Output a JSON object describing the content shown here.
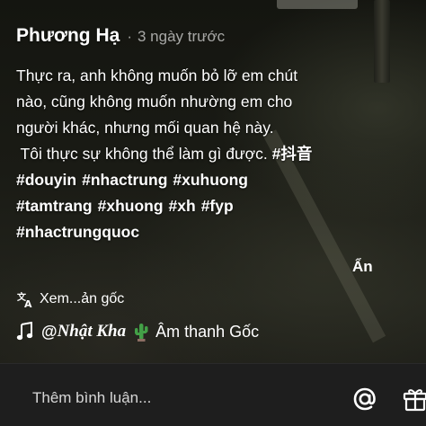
{
  "post": {
    "author": "Phương Hạ",
    "separator": "·",
    "time": "3 ngày trước",
    "caption_lines": [
      "Thực ra, anh không muốn bỏ lỡ em chút",
      "nào, cũng không muốn nhường em cho",
      "người khác, nhưng mối quan hệ này.",
      " Tôi thực sự không thể làm gì được."
    ],
    "hashtags": {
      "line1": [
        "#抖音"
      ],
      "line2": [
        "#douyin",
        "#nhactrung",
        "#xuhuong"
      ],
      "line3": [
        "#tamtrang",
        "#xhuong",
        "#xh",
        "#fyp"
      ],
      "line4": [
        "#nhactrungquoc"
      ]
    },
    "hide_label": "Ẩn",
    "translate_label": "Xem...ản gốc"
  },
  "music": {
    "at": "@",
    "user": "Nhật Kha",
    "sound": "Âm thanh Gốc"
  },
  "comment": {
    "placeholder": "Thêm bình luận..."
  },
  "icons": {
    "translate": "translate-icon",
    "note": "music-note-icon",
    "cactus": "cactus-emoji",
    "mention": "at-icon",
    "gift": "gift-icon"
  },
  "colors": {
    "text": "#ffffff",
    "muted": "#9a9a9a",
    "bottom_bar": "#1e1e1e",
    "cactus_green": "#4caf50"
  }
}
